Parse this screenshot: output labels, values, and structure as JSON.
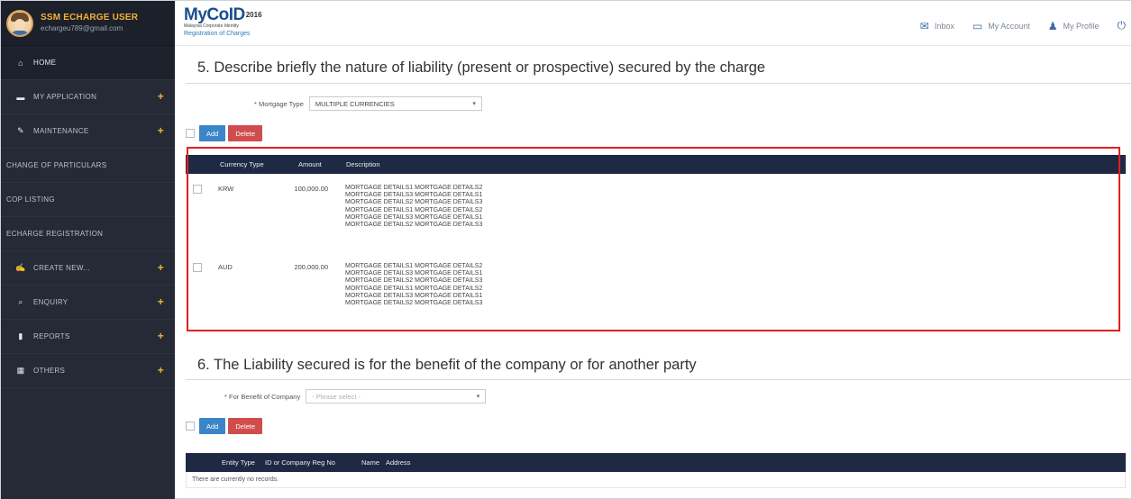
{
  "user": {
    "name": "SSM ECHARGE USER",
    "email": "echargeu789@gmail.com"
  },
  "sidebar": {
    "items": [
      {
        "label": "HOME",
        "icon": "home-icon",
        "plus": ""
      },
      {
        "label": "MY APPLICATION",
        "icon": "folder-icon",
        "plus": "+"
      },
      {
        "label": "MAINTENANCE",
        "icon": "wrench-icon",
        "plus": "+"
      },
      {
        "label": "CHANGE OF PARTICULARS",
        "icon": "",
        "plus": ""
      },
      {
        "label": "COP LISTING",
        "icon": "",
        "plus": ""
      },
      {
        "label": "ECHARGE REGISTRATION",
        "icon": "",
        "plus": ""
      },
      {
        "label": "CREATE NEW...",
        "icon": "edit-icon",
        "plus": "+"
      },
      {
        "label": "ENQUIRY",
        "icon": "search-icon",
        "plus": "+"
      },
      {
        "label": "REPORTS",
        "icon": "bookmark-icon",
        "plus": "+"
      },
      {
        "label": "OTHERS",
        "icon": "calendar-icon",
        "plus": "+"
      }
    ]
  },
  "header": {
    "logo": "MyCoID",
    "logo_year": "2016",
    "logo_tagline": "Malaysia Corporate Identity",
    "logo_sub": "Registration of Charges",
    "inbox": "Inbox",
    "my_account": "My Account",
    "my_profile": "My Profile"
  },
  "section5": {
    "title": "5. Describe briefly the nature of liability (present or prospective) secured by the charge",
    "mortgage_label": "* Mortgage Type",
    "mortgage_value": "MULTIPLE CURRENCIES",
    "add_label": "Add",
    "delete_label": "Delete",
    "columns": [
      "Currency Type",
      "Amount",
      "Description"
    ],
    "rows": [
      {
        "currency": "KRW",
        "amount": "100,000.00",
        "description": [
          "MORTGAGE DETAILS1 MORTGAGE DETAILS2",
          "MORTGAGE DETAILS3 MORTGAGE DETAILS1",
          "MORTGAGE DETAILS2 MORTGAGE DETAILS3",
          "MORTGAGE DETAILS1 MORTGAGE DETAILS2",
          "MORTGAGE DETAILS3 MORTGAGE DETAILS1",
          "MORTGAGE DETAILS2 MORTGAGE DETAILS3"
        ]
      },
      {
        "currency": "AUD",
        "amount": "200,000.00",
        "description": [
          "MORTGAGE DETAILS1 MORTGAGE DETAILS2",
          "MORTGAGE DETAILS3 MORTGAGE DETAILS1",
          "MORTGAGE DETAILS2 MORTGAGE DETAILS3",
          "MORTGAGE DETAILS1 MORTGAGE DETAILS2",
          "MORTGAGE DETAILS3 MORTGAGE DETAILS1",
          "MORTGAGE DETAILS2 MORTGAGE DETAILS3"
        ]
      }
    ]
  },
  "section6": {
    "title": "6. The Liability secured is for the benefit of the company or for another party",
    "benefit_label": "* For Benefit of Company",
    "benefit_placeholder": "- Please select -",
    "add_label": "Add",
    "delete_label": "Delete",
    "columns": [
      "Entity Type",
      "ID or Company Reg No",
      "Name",
      "Address"
    ],
    "empty_text": "There are currently no records."
  },
  "colors": {
    "sidebar_bg": "#252a36",
    "table_header_bg": "#1f2944",
    "accent_yellow": "#f2b134",
    "add_button": "#3a86c8",
    "delete_button": "#d04d4d",
    "highlight_border": "#e02020"
  }
}
